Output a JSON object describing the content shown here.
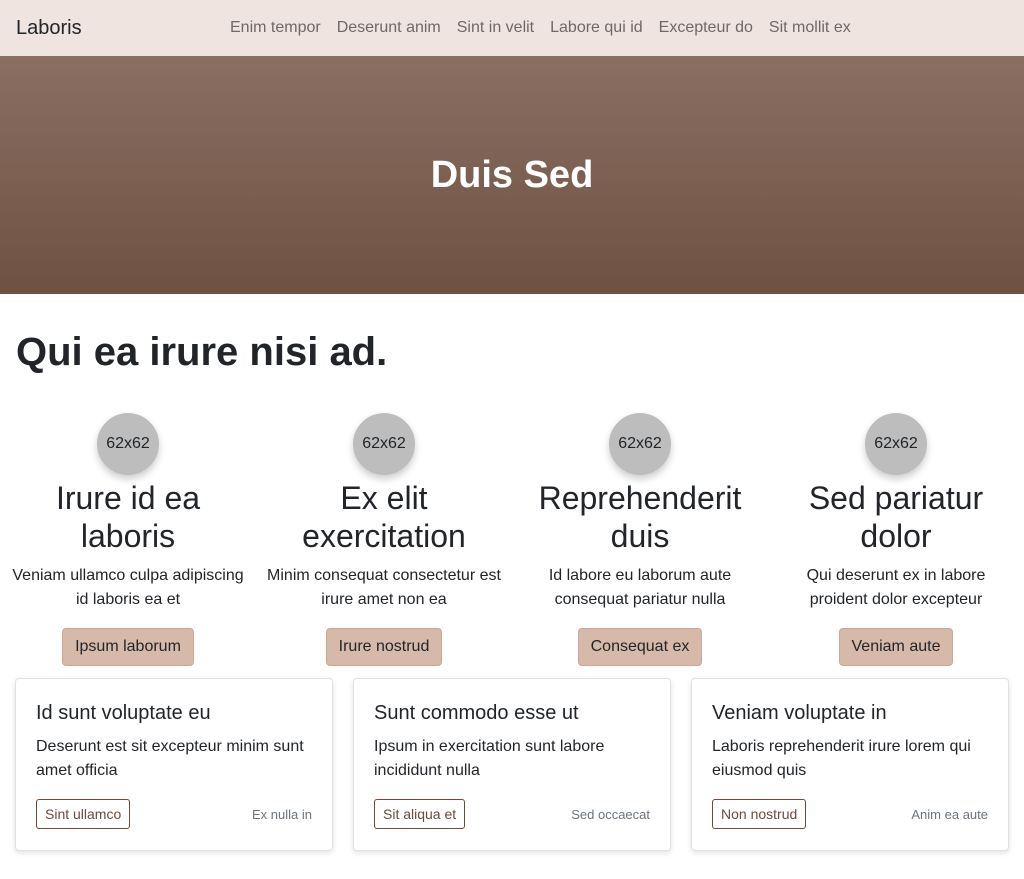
{
  "navbar": {
    "brand": "Laboris",
    "links": [
      "Enim tempor",
      "Deserunt anim",
      "Sint in velit",
      "Labore qui id",
      "Excepteur do",
      "Sit mollit ex"
    ]
  },
  "hero": {
    "title": "Duis Sed"
  },
  "main": {
    "heading": "Qui ea irure nisi ad."
  },
  "features": [
    {
      "avatar": "62x62",
      "title": "Irure id ea laboris",
      "text": "Veniam ullamco culpa adipiscing id laboris ea et",
      "button": "Ipsum laborum"
    },
    {
      "avatar": "62x62",
      "title": "Ex elit exercitation",
      "text": "Minim consequat consectetur est irure amet non ea",
      "button": "Irure nostrud"
    },
    {
      "avatar": "62x62",
      "title": "Reprehenderit duis",
      "text": "Id labore eu laborum aute consequat pariatur nulla",
      "button": "Consequat ex"
    },
    {
      "avatar": "62x62",
      "title": "Sed pariatur dolor",
      "text": "Qui deserunt ex in labore proident dolor excepteur",
      "button": "Veniam aute"
    }
  ],
  "cards": [
    {
      "title": "Id sunt voluptate eu",
      "text": "Deserunt est sit excepteur minim sunt amet officia",
      "button": "Sint ullamco",
      "meta": "Ex nulla in"
    },
    {
      "title": "Sunt commodo esse ut",
      "text": "Ipsum in exercitation sunt labore incididunt nulla",
      "button": "Sit aliqua et",
      "meta": "Sed occaecat"
    },
    {
      "title": "Veniam voluptate in",
      "text": "Laboris reprehenderit irure lorem qui eiusmod quis",
      "button": "Non nostrud",
      "meta": "Anim ea aute"
    }
  ],
  "colors": {
    "navbar_bg": "#efe4df",
    "hero_top": "#8a6f62",
    "hero_bottom": "#6f5142",
    "feature_button_bg": "#d7b9aa",
    "card_button_border": "#6d4a3a"
  }
}
